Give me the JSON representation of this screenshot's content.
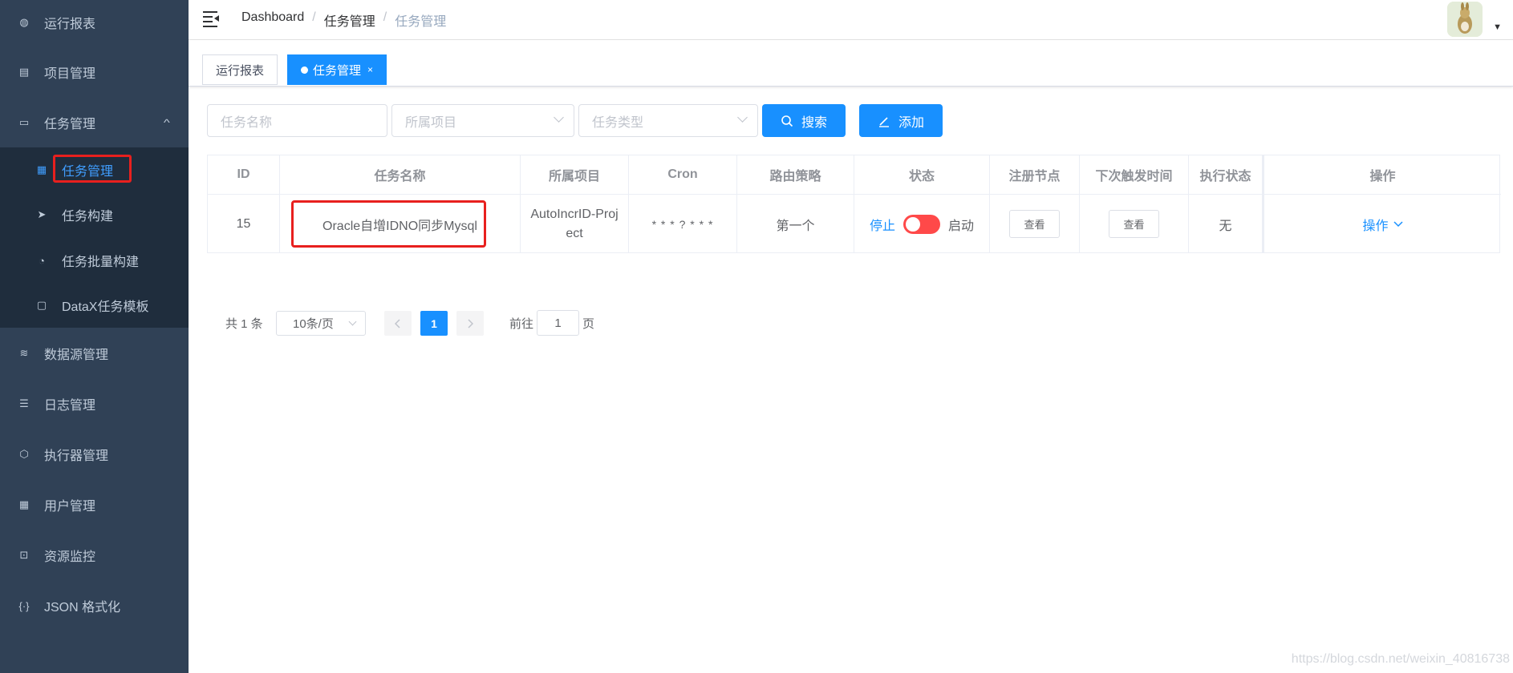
{
  "sidebar": {
    "items": [
      {
        "label": "运行报表",
        "icon": "dashboard-icon"
      },
      {
        "label": "项目管理",
        "icon": "project-icon"
      },
      {
        "label": "任务管理",
        "icon": "monitor-icon"
      },
      {
        "label": "数据源管理",
        "icon": "database-icon"
      },
      {
        "label": "日志管理",
        "icon": "log-icon"
      },
      {
        "label": "执行器管理",
        "icon": "executor-icon"
      },
      {
        "label": "用户管理",
        "icon": "table-icon"
      },
      {
        "label": "资源监控",
        "icon": "monitor-resource-icon"
      },
      {
        "label": "JSON 格式化",
        "icon": "json-icon"
      }
    ],
    "subitems": [
      {
        "label": "任务管理",
        "icon": "calendar-icon"
      },
      {
        "label": "任务构建",
        "icon": "paper-plane-icon"
      },
      {
        "label": "任务批量构建",
        "icon": "gauge-icon"
      },
      {
        "label": "DataX任务模板",
        "icon": "clipboard-icon"
      }
    ]
  },
  "breadcrumb": [
    "Dashboard",
    "任务管理",
    "任务管理"
  ],
  "tags": [
    {
      "label": "运行报表"
    },
    {
      "label": "任务管理",
      "close": "×"
    }
  ],
  "filters": {
    "task_name_placeholder": "任务名称",
    "project_placeholder": "所属项目",
    "task_type_placeholder": "任务类型",
    "search_label": "搜索",
    "add_label": "添加"
  },
  "table": {
    "headers": [
      "ID",
      "任务名称",
      "所属项目",
      "Cron",
      "路由策略",
      "状态",
      "注册节点",
      "下次触发时间",
      "执行状态",
      "操作"
    ],
    "row": {
      "id": "15",
      "name": "Oracle自增IDNO同步Mysql",
      "project": "AutoIncrID-Project",
      "cron": "* * * ? * * *",
      "route": "第一个",
      "status_off": "停止",
      "status_on": "启动",
      "node_btn": "查看",
      "next_btn": "查看",
      "exec_status": "无",
      "op": "操作"
    }
  },
  "pagination": {
    "total": "共 1 条",
    "page_size": "10条/页",
    "current": "1",
    "goto_label": "前往",
    "goto_value": "1",
    "page_suffix": "页"
  },
  "watermark": "https://blog.csdn.net/weixin_40816738",
  "colors": {
    "primary": "#1890ff",
    "sidebar": "#304156",
    "submenu": "#1f2d3d",
    "switch_off": "#ff4949",
    "highlight": "#e8201e"
  }
}
